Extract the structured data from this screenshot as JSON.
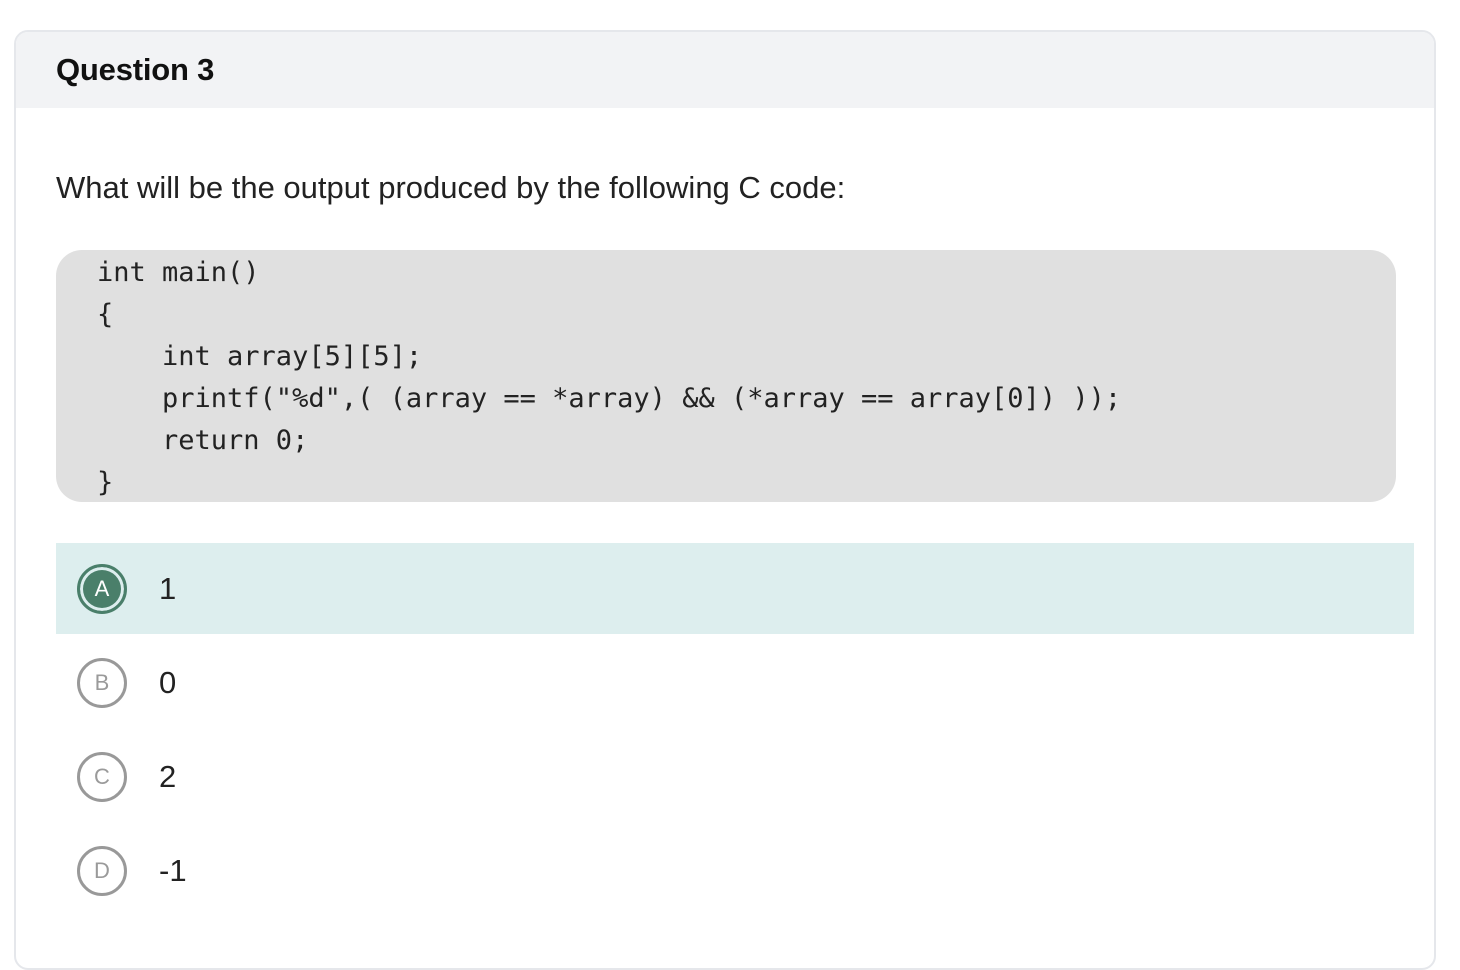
{
  "question": {
    "title": "Question 3",
    "prompt": "What will be the output produced by the following C code:",
    "code_lines": [
      "int main()",
      "{",
      "    int array[5][5];",
      "    printf(\"%d\",( (array == *array) && (*array == array[0]) ));",
      "    return 0;",
      "}"
    ]
  },
  "options": [
    {
      "letter": "A",
      "text": "1",
      "selected": true
    },
    {
      "letter": "B",
      "text": "0",
      "selected": false
    },
    {
      "letter": "C",
      "text": "2",
      "selected": false
    },
    {
      "letter": "D",
      "text": "-1",
      "selected": false
    }
  ],
  "colors": {
    "header_bg": "#f2f3f5",
    "code_bg": "#e0e0e0",
    "selected_bg": "#ddeeee",
    "selected_badge": "#4a7f6a",
    "unselected_badge_border": "#999999"
  }
}
